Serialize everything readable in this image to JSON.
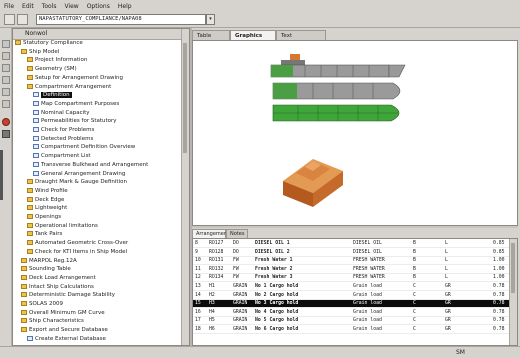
{
  "menu": [
    "File",
    "Edit",
    "Tools",
    "View",
    "Options",
    "Help"
  ],
  "toolbar": {
    "path": "NAPASTATUTORY_COMPLIANCE/NAPA08",
    "dropdown_arrow": "▾"
  },
  "nav": {
    "title": "Nonwol",
    "items": [
      {
        "label": "Statutory Compliance",
        "level": 0,
        "icon": "folder"
      },
      {
        "label": "Ship Model",
        "level": 1,
        "icon": "folder"
      },
      {
        "label": "Project Information",
        "level": 2,
        "icon": "folder"
      },
      {
        "label": "Geometry (SM)",
        "level": 2,
        "icon": "folder"
      },
      {
        "label": "Setup for Arrangement Drawing",
        "level": 2,
        "icon": "folder"
      },
      {
        "label": "Compartment Arrangement",
        "level": 2,
        "icon": "folder"
      },
      {
        "label": "Definition",
        "level": 3,
        "icon": "doc",
        "selected": true
      },
      {
        "label": "Map Compartment Purposes",
        "level": 3,
        "icon": "doc"
      },
      {
        "label": "Nominal Capacity",
        "level": 3,
        "icon": "doc"
      },
      {
        "label": "Permeabilities for Statutory",
        "level": 3,
        "icon": "doc"
      },
      {
        "label": "Check for Problems",
        "level": 3,
        "icon": "doc"
      },
      {
        "label": "Detected Problems",
        "level": 3,
        "icon": "doc"
      },
      {
        "label": "Compartment Definition Overview",
        "level": 3,
        "icon": "doc"
      },
      {
        "label": "Compartment List",
        "level": 3,
        "icon": "doc"
      },
      {
        "label": "Transverse Bulkhead and Arrangement",
        "level": 3,
        "icon": "doc"
      },
      {
        "label": "General Arrangement Drawing",
        "level": 3,
        "icon": "doc"
      },
      {
        "label": "Draught Mark & Gauge Definition",
        "level": 2,
        "icon": "folder"
      },
      {
        "label": "Wind Profile",
        "level": 2,
        "icon": "folder"
      },
      {
        "label": "Deck Edge",
        "level": 2,
        "icon": "folder"
      },
      {
        "label": "Lightweight",
        "level": 2,
        "icon": "folder"
      },
      {
        "label": "Openings",
        "level": 2,
        "icon": "folder"
      },
      {
        "label": "Operational limitations",
        "level": 2,
        "icon": "folder"
      },
      {
        "label": "Tank Pairs",
        "level": 2,
        "icon": "folder"
      },
      {
        "label": "Automated Geometric Cross-Over",
        "level": 2,
        "icon": "folder"
      },
      {
        "label": "Check for KTI Items in Ship Model",
        "level": 2,
        "icon": "folder"
      },
      {
        "label": "MARPOL Reg.12A",
        "level": 1,
        "icon": "folder"
      },
      {
        "label": "Sounding Table",
        "level": 1,
        "icon": "folder"
      },
      {
        "label": "Deck Load Arrangement",
        "level": 1,
        "icon": "folder"
      },
      {
        "label": "Intact Ship Calculations",
        "level": 1,
        "icon": "folder"
      },
      {
        "label": "Deterministic Damage Stability",
        "level": 1,
        "icon": "folder"
      },
      {
        "label": "SOLAS 2009",
        "level": 1,
        "icon": "folder"
      },
      {
        "label": "Overall Minimum GM Curve",
        "level": 1,
        "icon": "folder"
      },
      {
        "label": "Ship Characteristics",
        "level": 1,
        "icon": "folder"
      },
      {
        "label": "Export and Secure Database",
        "level": 1,
        "icon": "folder"
      },
      {
        "label": "Create External Database",
        "level": 2,
        "icon": "doc"
      }
    ]
  },
  "tabs": [
    {
      "label": "Table Viewer",
      "active": false
    },
    {
      "label": "Graphics Viewer",
      "active": true
    },
    {
      "label": "Text Viewer/Help",
      "active": false
    }
  ],
  "bottom_tabs": [
    {
      "label": "Arrangement",
      "active": true
    },
    {
      "label": "Notes",
      "active": false
    }
  ],
  "table": {
    "rows": [
      [
        "8",
        "RO127",
        "DO",
        "DIESEL OIL 1",
        "DIESEL OIL",
        "B",
        "L",
        "0.85"
      ],
      [
        "9",
        "RO128",
        "DO",
        "DIESEL OIL 2",
        "DIESEL OIL",
        "B",
        "L",
        "0.85"
      ],
      [
        "10",
        "RO131",
        "FW",
        "Fresh Water 1",
        "FRESH WATER",
        "B",
        "L",
        "1.00"
      ],
      [
        "11",
        "RO132",
        "FW",
        "Fresh Water 2",
        "FRESH WATER",
        "B",
        "L",
        "1.00"
      ],
      [
        "12",
        "RO134",
        "FW",
        "Fresh Water 3",
        "FRESH WATER",
        "B",
        "L",
        "1.00"
      ],
      [
        "13",
        "H1",
        "GRAIN",
        "No 1 Cargo hold",
        "Grain load",
        "C",
        "GR",
        "0.78"
      ],
      [
        "14",
        "H2",
        "GRAIN",
        "No 2 Cargo hold",
        "Grain load",
        "C",
        "GR",
        "0.78"
      ],
      [
        "15",
        "H3",
        "GRAIN",
        "No 3 Cargo hold",
        "Grain load",
        "C",
        "GR",
        "0.78"
      ],
      [
        "16",
        "H4",
        "GRAIN",
        "No 4 Cargo hold",
        "Grain load",
        "C",
        "GR",
        "0.78"
      ],
      [
        "17",
        "H5",
        "GRAIN",
        "No 5 Cargo hold",
        "Grain load",
        "C",
        "GR",
        "0.78"
      ],
      [
        "18",
        "H6",
        "GRAIN",
        "No 6 Cargo hold",
        "Grain load",
        "C",
        "GR",
        "0.78"
      ]
    ],
    "selected_row": 7
  },
  "status": {
    "text": "SM"
  },
  "colors": {
    "accent_selection": "#0c0c0c",
    "tank_green": "#3fa63a",
    "cargo_gray": "#9a9a9a",
    "block_orange": "#c56a2a"
  }
}
